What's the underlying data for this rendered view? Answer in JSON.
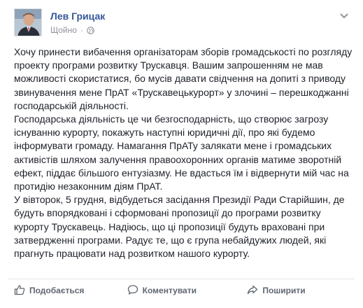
{
  "post": {
    "author": "Лев Грицак",
    "timestamp": "Щойно",
    "paragraphs": [
      "Хочу принести вибачення організаторам зборів громадськості по розгляду проекту програми розвитку Трускавця. Вашим запрошенням не мав можливості скористатися, бо мусів давати свідчення на допиті з приводу звинувачення мене ПрАТ «Трускавецькурорт» у злочині – перешкоджанні господарській діяльності.",
      "Господарська діяльність це чи безгосподарність, що створює загрозу існуванню курорту, покажуть наступні юридичні дії, про які будемо інформувати громаду. Намагання ПрАТу залякати мене і громадських активістів шляхом залучення правоохоронних органів матиме зворотній ефект, піддає більшого ентузіазму. Не вдасться їм і відвернути мій час на протидію незаконним діям ПрАТ.",
      "У вівторок, 5 грудня, відбудеться засідання Президії Ради Старійшин, де будуть впорядковані і сформовані пропозиції до програми розвитку курорту Трускавець. Надіюсь, що ці пропозиції будуть враховані при затвердженні програми. Радує те, що є група небайдужих людей, які прагнуть працювати над розвитком нашого курорту."
    ]
  },
  "actions": {
    "like": "Подобається",
    "comment": "Коментувати",
    "share": "Поширити"
  },
  "colors": {
    "author_link": "#365899",
    "meta": "#90949c",
    "action_text": "#606770"
  },
  "icons": [
    "globe-icon",
    "chevron-down-icon",
    "like-icon",
    "comment-icon",
    "share-icon"
  ]
}
